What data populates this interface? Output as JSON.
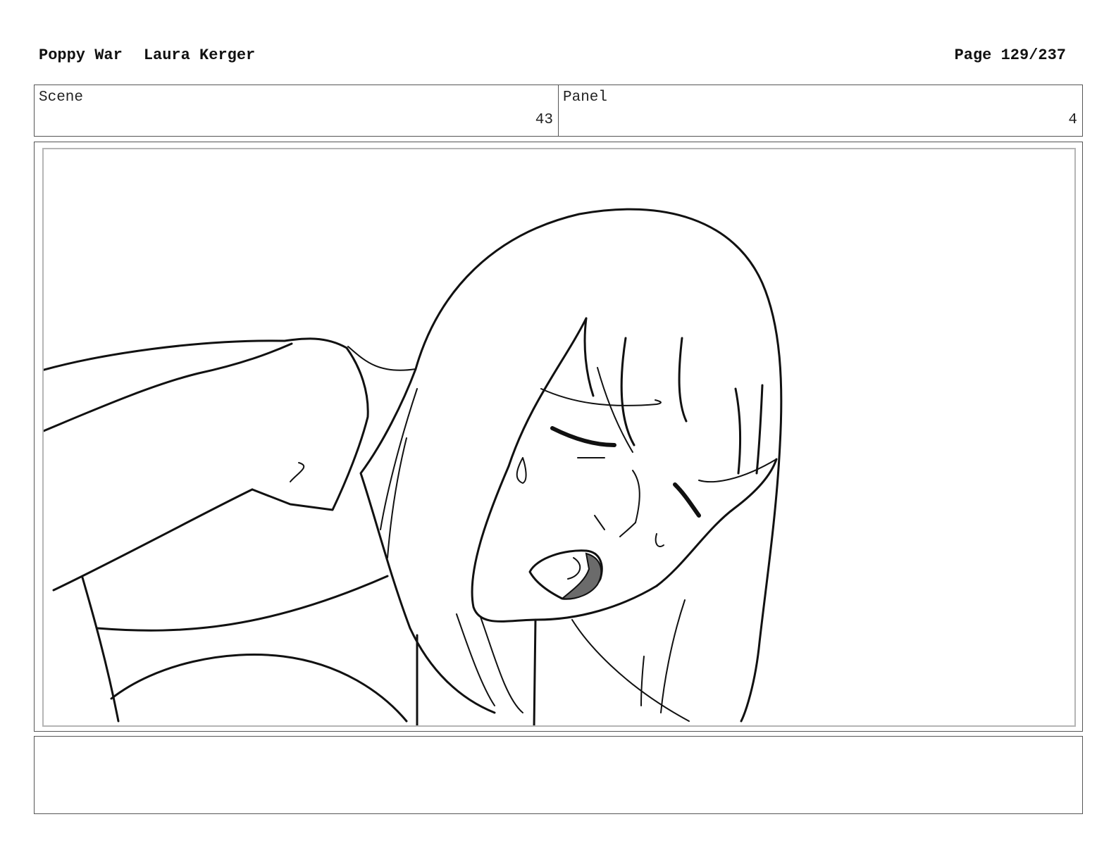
{
  "header": {
    "project": "Poppy War",
    "author": "Laura Kerger",
    "page": "Page 129/237"
  },
  "info": {
    "scene_label": "Scene",
    "scene_number": "43",
    "panel_label": "Panel",
    "panel_number": "4"
  },
  "drawing": {
    "subject": "storyboard-sketch",
    "colors": {
      "line": "#111111",
      "mouth_shade": "#6b6b6b",
      "frame_border": "#b5b5b5"
    }
  },
  "notes": {
    "text": ""
  }
}
